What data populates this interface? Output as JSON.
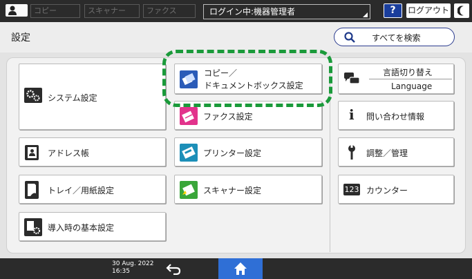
{
  "topbar": {
    "tabs": [
      "コピー",
      "スキャナー",
      "ファクス"
    ],
    "login_status": "ログイン中:機器管理者",
    "help_label": "?",
    "logout_label": "ログアウト"
  },
  "header": {
    "title": "設定",
    "search_all_label": "すべてを検索"
  },
  "tiles": {
    "copy_docbox_line1": "コピー／",
    "copy_docbox_line2": "ドキュメントボックス設定",
    "system": "システム設定",
    "fax": "ファクス設定",
    "address_book": "アドレス帳",
    "printer": "プリンター設定",
    "tray_paper": "トレイ／用紙設定",
    "scanner": "スキャナー設定",
    "intro_basic": "導入時の基本設定",
    "language_line1": "言語切り替え",
    "language_line2": "Language",
    "inquiry": "問い合わせ情報",
    "maintenance": "調整／管理",
    "counter_badge": "123",
    "counter": "カウンター"
  },
  "bottombar": {
    "date": "30 Aug. 2022",
    "time": "16:35"
  },
  "colors": {
    "accent_blue": "#2f6fd6",
    "highlight_green": "#1a9a3a",
    "help_blue": "#1a3e9c"
  }
}
